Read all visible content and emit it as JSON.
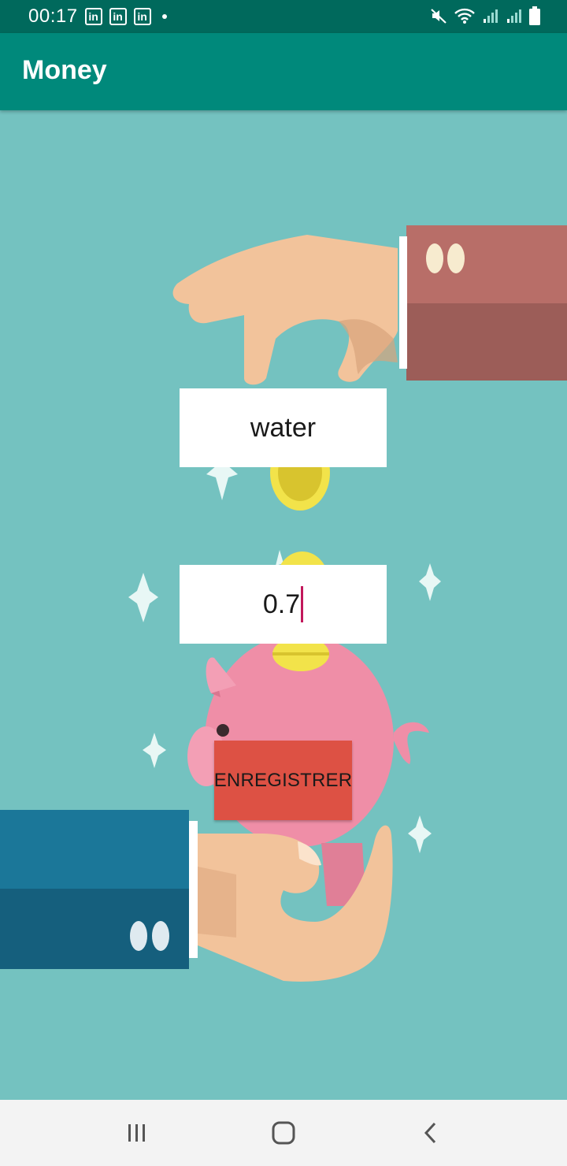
{
  "status_bar": {
    "time": "00:17",
    "notification_icons": [
      "linkedin-icon",
      "linkedin-icon",
      "linkedin-icon"
    ],
    "indicator_icons": [
      "mute-icon",
      "wifi-icon",
      "signal-icon",
      "signal-icon",
      "battery-icon"
    ]
  },
  "app_bar": {
    "title": "Money"
  },
  "form": {
    "name_value": "water",
    "amount_value": "0.7",
    "save_label": "ENREGISTRER"
  },
  "nav_bar": {
    "buttons": [
      "recent-apps-icon",
      "home-icon",
      "back-icon"
    ]
  },
  "colors": {
    "status_bar": "#00695c",
    "app_bar": "#00897b",
    "background": "#74c2c0",
    "save_button": "#dd5144",
    "caret": "#c2185b"
  }
}
